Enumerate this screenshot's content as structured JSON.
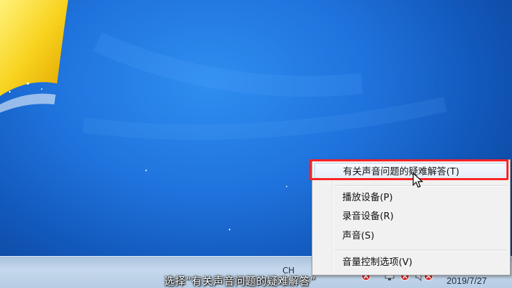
{
  "desktop": {
    "wallpaper_colors": {
      "main": "#1f72dc",
      "light": "#2f8ef0",
      "dark": "#0d469c"
    }
  },
  "context_menu": {
    "items": [
      {
        "label": "有关声音问题的疑难解答(T)",
        "highlighted": true
      },
      {
        "label": "播放设备(P)"
      },
      {
        "label": "录音设备(R)"
      },
      {
        "label": "声音(S)"
      },
      {
        "label": "音量控制选项(V)"
      }
    ],
    "highlight_color": "#ff2222"
  },
  "taskbar": {
    "language": "CH",
    "date": "2019/7/27",
    "tray_icons": [
      "monitor-icon",
      "error-badge-icon",
      "network-icon",
      "error-badge-icon",
      "volume-icon",
      "error-badge-icon"
    ]
  },
  "caption": {
    "text": "选择“有关声音问题的疑难解答”"
  }
}
